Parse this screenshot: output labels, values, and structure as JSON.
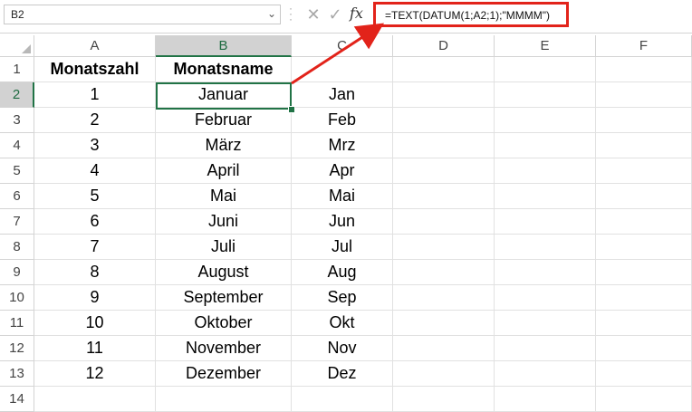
{
  "formula_bar": {
    "name_box": "B2",
    "formula": "=TEXT(DATUM(1;A2;1);\"MMMM\")",
    "fx_label": "fx"
  },
  "columns": [
    "A",
    "B",
    "C",
    "D",
    "E",
    "F"
  ],
  "rows": [
    "1",
    "2",
    "3",
    "4",
    "5",
    "6",
    "7",
    "8",
    "9",
    "10",
    "11",
    "12",
    "13",
    "14"
  ],
  "table": {
    "header_a": "Monatszahl",
    "header_b": "Monatsname",
    "data": [
      {
        "num": "1",
        "month": "Januar",
        "short": "Jan"
      },
      {
        "num": "2",
        "month": "Februar",
        "short": "Feb"
      },
      {
        "num": "3",
        "month": "März",
        "short": "Mrz"
      },
      {
        "num": "4",
        "month": "April",
        "short": "Apr"
      },
      {
        "num": "5",
        "month": "Mai",
        "short": "Mai"
      },
      {
        "num": "6",
        "month": "Juni",
        "short": "Jun"
      },
      {
        "num": "7",
        "month": "Juli",
        "short": "Jul"
      },
      {
        "num": "8",
        "month": "August",
        "short": "Aug"
      },
      {
        "num": "9",
        "month": "September",
        "short": "Sep"
      },
      {
        "num": "10",
        "month": "Oktober",
        "short": "Okt"
      },
      {
        "num": "11",
        "month": "November",
        "short": "Nov"
      },
      {
        "num": "12",
        "month": "Dezember",
        "short": "Dez"
      }
    ]
  },
  "colors": {
    "highlight": "#e2231a",
    "selection": "#217346"
  }
}
